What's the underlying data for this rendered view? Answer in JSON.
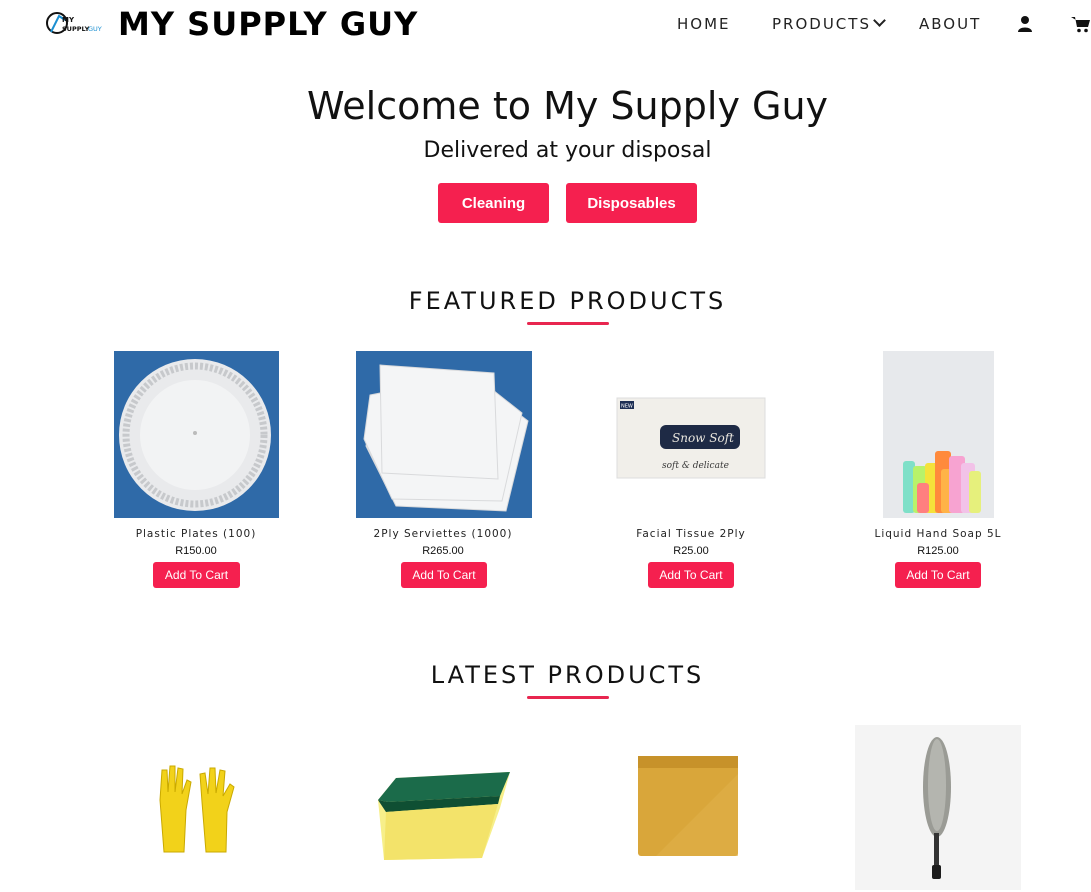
{
  "nav": {
    "brand": "MY SUPPLY GUY",
    "logo_text_my": "MY",
    "logo_text_supply": "SUPPLY",
    "logo_text_guy": "GUY",
    "links": [
      "HOME",
      "PRODUCTS",
      "ABOUT"
    ],
    "icons": [
      "user-icon",
      "cart-icon"
    ]
  },
  "hero": {
    "title": "Welcome to My Supply Guy",
    "subtitle": "Delivered at your disposal",
    "buttons": [
      "Cleaning",
      "Disposables"
    ]
  },
  "featured": {
    "heading": "FEATURED PRODUCTS",
    "products": [
      {
        "name": "Plastic Plates (100)",
        "price": "R150.00",
        "cta": "Add To Cart"
      },
      {
        "name": "2Ply Serviettes (1000)",
        "price": "R265.00",
        "cta": "Add To Cart"
      },
      {
        "name": "Facial Tissue 2Ply",
        "price": "R25.00",
        "cta": "Add To Cart",
        "image_text": {
          "badge": "NEW",
          "brand": "Snow Soft",
          "tagline": "soft & delicate"
        }
      },
      {
        "name": "Liquid Hand Soap 5L",
        "price": "R125.00",
        "cta": "Add To Cart"
      }
    ]
  },
  "latest": {
    "heading": "LATEST PRODUCTS",
    "products": [
      "gloves-image",
      "sponge-image",
      "cloth-image",
      "duster-image"
    ]
  },
  "colors": {
    "accent": "#f5204f",
    "underline": "#e8264f",
    "text": "#111111"
  }
}
